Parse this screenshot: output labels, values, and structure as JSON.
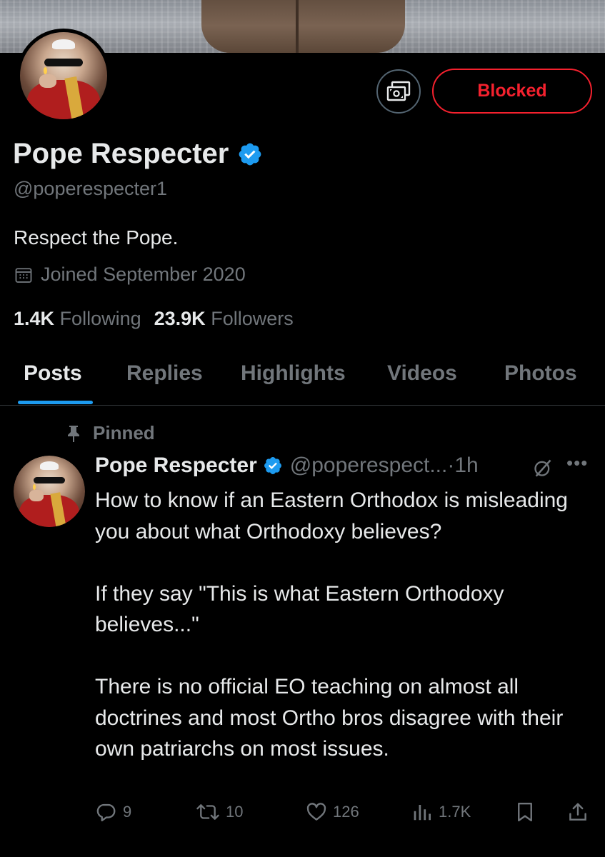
{
  "profile": {
    "display_name": "Pope Respecter",
    "handle": "@poperespecter1",
    "bio": "Respect the Pope.",
    "joined": "Joined September 2020",
    "following_count": "1.4K",
    "following_label": "Following",
    "followers_count": "23.9K",
    "followers_label": "Followers",
    "verified": true
  },
  "actions": {
    "blocked_label": "Blocked",
    "subscribe_icon": "subscribe-money-icon"
  },
  "tabs": [
    {
      "label": "Posts",
      "active": true
    },
    {
      "label": "Replies",
      "active": false
    },
    {
      "label": "Highlights",
      "active": false
    },
    {
      "label": "Videos",
      "active": false
    },
    {
      "label": "Photos",
      "active": false
    }
  ],
  "post": {
    "pinned_label": "Pinned",
    "author_name": "Pope Respecter",
    "author_handle": "@poperespect...",
    "separator": "·",
    "time": "1h",
    "paragraphs": [
      "How to know if an Eastern Orthodox is misleading you about what Orthodoxy believes?",
      "If they say \"This is what Eastern Orthodoxy believes...\"",
      "There is no official EO teaching on almost all doctrines and most Ortho bros disagree with their own patriarchs on most issues."
    ],
    "stats": {
      "replies": "9",
      "reposts": "10",
      "likes": "126",
      "views": "1.7K"
    }
  },
  "colors": {
    "background": "#000000",
    "text_primary": "#e7e9ea",
    "text_secondary": "#71767b",
    "accent_blue": "#1d9bf0",
    "blocked_red": "#f4212e"
  }
}
